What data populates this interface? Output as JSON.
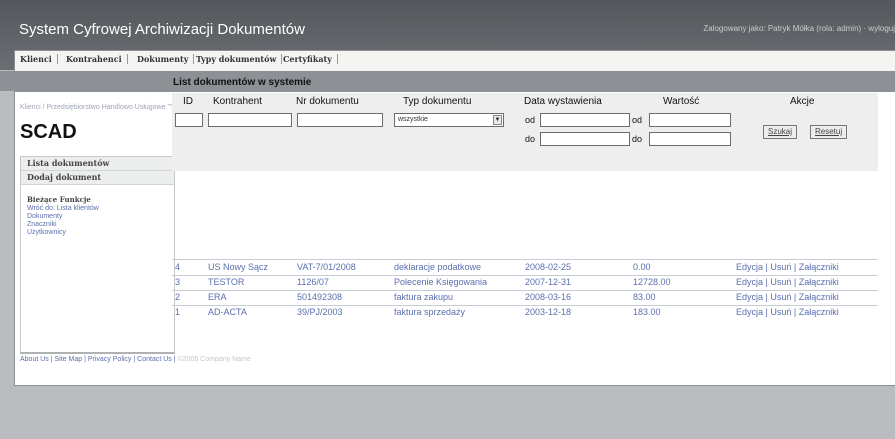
{
  "app": {
    "title": "System Cyfrowej Archiwizacji Dokumentów",
    "login_info": "Zalogowany jako: Patryk Mółka (rola: admin) · wyloguj"
  },
  "menu": [
    "Klienci",
    "Kontrahenci",
    "Dokumenty",
    "Typy dokumentów",
    "Certyfikaty"
  ],
  "breadcrumb": "Klienci / Przedsiębiorstwo Handlowo Usługowe \"TESTOR\" S.A. / Lista dokumentów",
  "logo": {
    "text": "SCAD",
    "small_logo": "small logo"
  },
  "sidebar": {
    "items": [
      "Lista dokumentów",
      "Dodaj dokument"
    ],
    "section": "Bieżące Funkcje",
    "links": [
      "Wróć do: Lista klientów",
      "Dokumenty",
      "Znaczniki",
      "Użytkownicy"
    ]
  },
  "content": {
    "title": "List dokumentów w systemie"
  },
  "table": {
    "headers": [
      "ID",
      "Kontrahent",
      "Nr dokumentu",
      "Typ dokumentu",
      "Data wystawienia",
      "Wartość",
      "Akcje"
    ],
    "filters": {
      "id": "",
      "kontrahent": "",
      "nr": "",
      "typ_selected": "wszystkie",
      "od_label": "od",
      "do_label": "do",
      "date_from": "",
      "date_to": "",
      "value_from": "",
      "value_to": ""
    },
    "buttons": {
      "search": "Szukaj",
      "reset": "Resetuj"
    },
    "rows": [
      {
        "id": "4",
        "kontrahent": "US Nowy Sącz",
        "nr": "VAT-7/01/2008",
        "typ": "deklaracje podatkowe",
        "data": "2008-02-25",
        "wartosc": "0.00"
      },
      {
        "id": "3",
        "kontrahent": "TESTOR",
        "nr": "1126/07",
        "typ": "Polecenie Księgowania",
        "data": "2007-12-31",
        "wartosc": "12728.00"
      },
      {
        "id": "2",
        "kontrahent": "ERA",
        "nr": "501492308",
        "typ": "faktura zakupu",
        "data": "2008-03-16",
        "wartosc": "83.00"
      },
      {
        "id": "1",
        "kontrahent": "AD-ACTA",
        "nr": "39/PJ/2003",
        "typ": "faktura sprzedaży",
        "data": "2003-12-18",
        "wartosc": "183.00"
      }
    ],
    "actions": {
      "edit": "Edycja",
      "delete": "Usuń",
      "attachments": "Załączniki",
      "sep": " | "
    }
  },
  "footer": {
    "links": [
      "About Us",
      "Site Map",
      "Privacy Policy",
      "Contact Us"
    ],
    "sep": " | ",
    "copyright": "©2005 Company Name"
  }
}
